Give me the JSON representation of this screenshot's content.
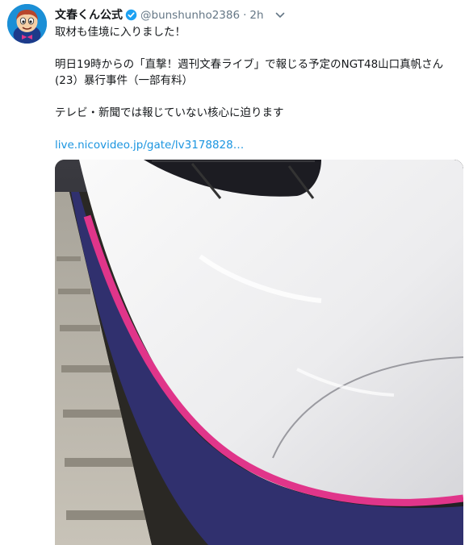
{
  "tweet": {
    "display_name": "文春くん公式",
    "handle": "@bunshunho2386",
    "separator": "·",
    "time": "2h",
    "lines": [
      "取材も佳境に入りました！",
      "",
      "明日19時からの「直撃！週刊文春ライブ」で報じる予定のNGT48山口真帆さん",
      "(23）暴行事件（一部有料）",
      "",
      "テレビ・新聞では報じていない核心に迫ります",
      ""
    ],
    "link": "live.nicovideo.jp/gate/lv3178828…"
  },
  "icons": {
    "avatar": "bunshun-mascot-avatar",
    "verified": "verified-badge-icon",
    "caret": "chevron-down-icon"
  },
  "colors": {
    "link": "#1b95e0",
    "muted": "#657786",
    "verified": "#1da1f2",
    "train_stripe_pink": "#e0358a",
    "train_underbody": "#30306e"
  }
}
